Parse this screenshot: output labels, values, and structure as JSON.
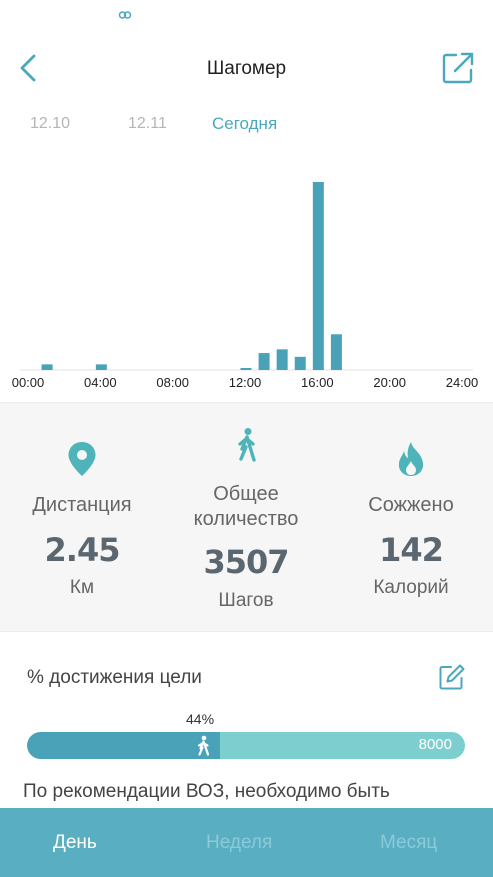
{
  "header": {
    "title": "Шагомер"
  },
  "date_tabs": [
    {
      "label": "12.10"
    },
    {
      "label": "12.11"
    },
    {
      "label": "Сегодня",
      "active": true
    }
  ],
  "chart_data": {
    "type": "bar",
    "xlabel": "",
    "ylabel": "",
    "x_ticks": [
      "00:00",
      "04:00",
      "08:00",
      "12:00",
      "16:00",
      "20:00",
      "24:00"
    ],
    "categories": [
      "01:00",
      "04:00",
      "12:00",
      "13:00",
      "14:00",
      "15:00",
      "16:00",
      "17:00"
    ],
    "values": [
      3,
      3,
      1,
      9,
      11,
      7,
      100,
      19
    ],
    "ylim": [
      0,
      100
    ],
    "color": "#4aa2b8",
    "grid": false
  },
  "stats": {
    "distance": {
      "label": "Дистанция",
      "value": "2.45",
      "unit": "Км"
    },
    "steps": {
      "label_line1": "Общее",
      "label_line2": "количество",
      "value": "3507",
      "unit": "Шагов"
    },
    "calories": {
      "label": "Сожжено",
      "value": "142",
      "unit": "Калорий"
    }
  },
  "goal": {
    "title": "% достижения цели",
    "percent_label": "44%",
    "progress": 0.44,
    "target": "8000",
    "note": "По рекомендации ВОЗ, необходимо быть"
  },
  "nav": [
    {
      "label": "День",
      "active": true
    },
    {
      "label": "Неделя",
      "active": false
    },
    {
      "label": "Месяц",
      "active": false
    }
  ],
  "colors": {
    "accent": "#4aa8bd",
    "bar": "#4aa2b8",
    "track": "#7dcfcf",
    "nav_bg": "#5aaec2"
  }
}
